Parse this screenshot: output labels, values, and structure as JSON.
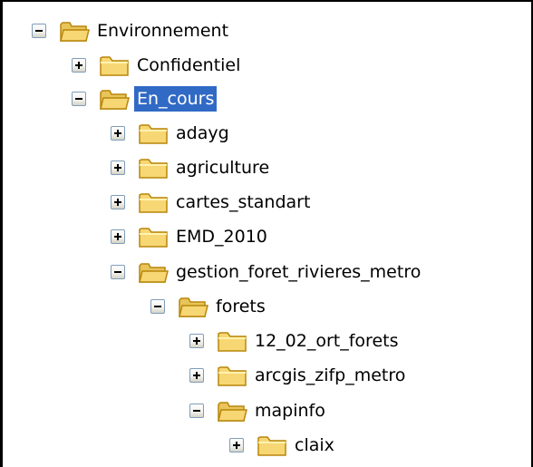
{
  "tree": {
    "nodes": [
      {
        "label": "Environnement",
        "expanded": true,
        "depth": 0,
        "selected": false
      },
      {
        "label": "Confidentiel",
        "expanded": false,
        "depth": 1,
        "selected": false
      },
      {
        "label": "En_cours",
        "expanded": true,
        "depth": 1,
        "selected": true
      },
      {
        "label": "adayg",
        "expanded": false,
        "depth": 2,
        "selected": false
      },
      {
        "label": "agriculture",
        "expanded": false,
        "depth": 2,
        "selected": false
      },
      {
        "label": "cartes_standart",
        "expanded": false,
        "depth": 2,
        "selected": false
      },
      {
        "label": "EMD_2010",
        "expanded": false,
        "depth": 2,
        "selected": false
      },
      {
        "label": "gestion_foret_rivieres_metro",
        "expanded": true,
        "depth": 2,
        "selected": false
      },
      {
        "label": "forets",
        "expanded": true,
        "depth": 3,
        "selected": false
      },
      {
        "label": "12_02_ort_forets",
        "expanded": false,
        "depth": 4,
        "selected": false
      },
      {
        "label": "arcgis_zifp_metro",
        "expanded": false,
        "depth": 4,
        "selected": false
      },
      {
        "label": "mapinfo",
        "expanded": true,
        "depth": 4,
        "selected": false
      },
      {
        "label": "claix",
        "expanded": false,
        "depth": 5,
        "selected": false
      }
    ]
  },
  "colors": {
    "selection": "#316ac5",
    "folder_fill": "#f7d774",
    "folder_stroke": "#b8860b"
  },
  "icons": {
    "expand": "plus-box-icon",
    "collapse": "minus-box-icon",
    "folder": "folder-icon"
  }
}
